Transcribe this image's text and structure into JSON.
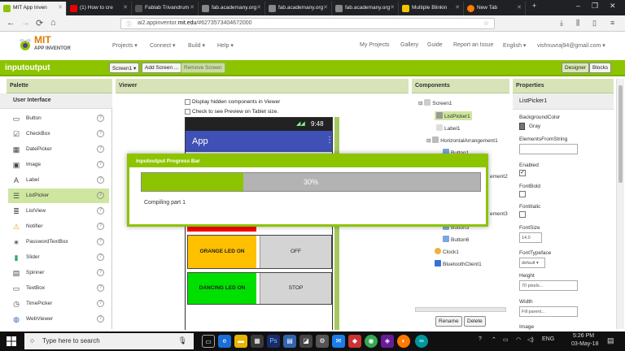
{
  "browser": {
    "tabs": [
      {
        "label": "MIT App Inven",
        "active": true,
        "icon": "mit-app-inventor-icon"
      },
      {
        "label": "(1) How to cre",
        "active": false,
        "icon": "youtube-icon"
      },
      {
        "label": "Fablab Trivandrum",
        "active": false,
        "icon": "fablab-icon"
      },
      {
        "label": "fab.academany.org",
        "active": false,
        "icon": "page-icon"
      },
      {
        "label": "fab.academany.org",
        "active": false,
        "icon": "page-icon"
      },
      {
        "label": "fab.academany.org",
        "active": false,
        "icon": "page-icon"
      },
      {
        "label": "Multiple Blinkin",
        "active": false,
        "icon": "instructables-icon"
      },
      {
        "label": "New Tab",
        "active": false,
        "icon": "firefox-icon"
      }
    ],
    "new_tab": "+",
    "url_prefix": "ai2.appinventor.",
    "url_domain": "mit.edu",
    "url_suffix": "/#6273573404672000",
    "nav": {
      "back": "←",
      "forward": "→",
      "reload": "⟳",
      "home": "⌂"
    }
  },
  "app": {
    "logo_mit": "MIT",
    "logo_sub": "APP INVENTOR",
    "menu": [
      "Projects ▾",
      "Connect ▾",
      "Build ▾",
      "Help ▾"
    ],
    "right_menu": [
      "My Projects",
      "Gallery",
      "Guide",
      "Report an Issue",
      "English ▾",
      "vishnuvraj94@gmail.com ▾"
    ],
    "project_name": "inputoutput",
    "screen_button": "Screen1 ▾",
    "add_screen": "Add Screen ...",
    "remove_screen": "Remove Screen",
    "designer": "Designer",
    "blocks": "Blocks"
  },
  "palette": {
    "header": "Palette",
    "section": "User Interface",
    "items": [
      "Button",
      "CheckBox",
      "DatePicker",
      "Image",
      "Label",
      "ListPicker",
      "ListView",
      "Notifier",
      "PasswordTextBox",
      "Slider",
      "Spinner",
      "TextBox",
      "TimePicker",
      "WebViewer"
    ],
    "selected_index": 5
  },
  "viewer": {
    "header": "Viewer",
    "display_hidden": "Display hidden components in Viewer",
    "tablet_preview": "Check to see Preview on Tablet size.",
    "phone_time": "9:48",
    "app_title": "App",
    "rows": [
      {
        "left": "ORANGE LED ON",
        "left_color": "#ffc000",
        "right": "OFF"
      },
      {
        "left": "DANCING LED ON",
        "left_color": "#00e000",
        "right": "STOP"
      }
    ],
    "red_bar_color": "#ff0000"
  },
  "components": {
    "header": "Components",
    "tree": [
      {
        "label": "Screen1",
        "level": 0,
        "toggle": "⊟"
      },
      {
        "label": "ListPicker1",
        "level": 1,
        "selected": true
      },
      {
        "label": "Label1",
        "level": 1
      },
      {
        "label": "HorizontalArrangement1",
        "level": 1,
        "toggle": "⊟"
      },
      {
        "label": "Button1",
        "level": 2
      },
      {
        "label": "ement2",
        "level": 2
      },
      {
        "label": "Button3",
        "level": 2
      },
      {
        "label": "ement3",
        "level": 2
      },
      {
        "label": "Button6",
        "level": 2
      },
      {
        "label": "Clock1",
        "level": 1
      },
      {
        "label": "BluetoothClient1",
        "level": 1
      }
    ],
    "rename": "Rename",
    "delete": "Delete"
  },
  "properties": {
    "header": "Properties",
    "component": "ListPicker1",
    "background_color_label": "BackgroundColor",
    "background_color_value": "Gray",
    "elements_label": "ElementsFromString",
    "enabled_label": "Enabled",
    "fontbold_label": "FontBold",
    "fontitalic_label": "FontItalic",
    "fontsize_label": "FontSize",
    "fontsize_value": "14.0",
    "typeface_label": "FontTypeface",
    "typeface_value": "default ▾",
    "height_label": "Height",
    "height_value": "70 pixels...",
    "width_label": "Width",
    "width_value": "Fill parent...",
    "image_label": "Image",
    "checkmark": "✓"
  },
  "progress_dialog": {
    "title": "inputoutput Progress Bar",
    "percent_label": "30%",
    "fraction": 0.3,
    "status": "Compiling part 1"
  },
  "taskbar": {
    "search_placeholder": "Type here to search",
    "time": "5:26 PM",
    "date": "03-May-18",
    "lang": "ENG"
  },
  "colors": {
    "accent": "#8dc400",
    "app_blue": "#3f51b5"
  }
}
